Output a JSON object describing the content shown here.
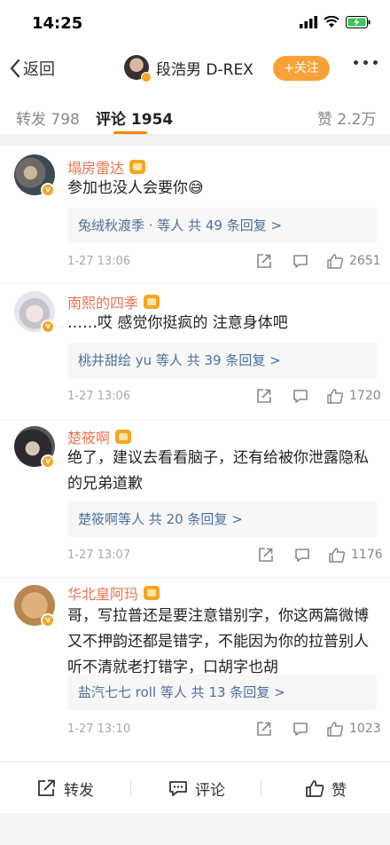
{
  "status": {
    "time": "14:25"
  },
  "nav": {
    "back_label": "返回",
    "user_name": "段浩男 D-REX",
    "follow_label": "+关注"
  },
  "tabs": {
    "repost": {
      "label": "转发",
      "count": "798"
    },
    "comment": {
      "label": "评论",
      "count": "1954"
    },
    "like": {
      "label": "赞",
      "count": "2.2万"
    }
  },
  "comments": [
    {
      "name": "塌房雷达",
      "text": "参加也没人会要你😅",
      "reply_who": "兔绒秋渡季 · 等人",
      "reply_count": "共 49 条回复 >",
      "time": "1-27 13:06",
      "likes": "2651"
    },
    {
      "name": "南熙的四季",
      "text": "……哎 感觉你挺疯的 注意身体吧",
      "reply_who": "桃井甜绘 yu 等人",
      "reply_count": "共 39 条回复 >",
      "time": "1-27 13:06",
      "likes": "1720"
    },
    {
      "name": "楚筱啊",
      "text": "绝了，建议去看看脑子，还有给被你泄露隐私的兄弟道歉",
      "reply_who": "楚筱啊等人",
      "reply_count": "共 20 条回复 >",
      "time": "1-27 13:07",
      "likes": "1176"
    },
    {
      "name": "华北皇阿玛",
      "text": "哥，写拉普还是要注意错别字，你这两篇微博又不押韵还都是错字，不能因为你的拉普别人听不清就老打错字，口胡字也胡",
      "reply_who": "盐汽七七 roll 等人",
      "reply_count": "共 13 条回复 >",
      "time": "1-27 13:10",
      "likes": "1023"
    }
  ],
  "bottom": {
    "repost_label": "转发",
    "comment_label": "评论",
    "like_label": "赞"
  },
  "colors": {
    "accent": "#ff8200",
    "name": "#eb7350",
    "link": "#4f6f9c",
    "follow": "#f7a238"
  }
}
